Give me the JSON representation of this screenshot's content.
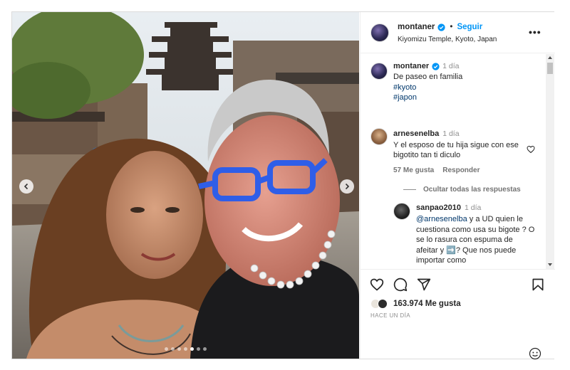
{
  "post": {
    "username": "montaner",
    "follow_label": "Seguir",
    "separator": "•",
    "location": "Kiyomizu Temple, Kyoto, Japan",
    "more_label": "•••",
    "media_dots_total": 7,
    "media_dots_active": 4
  },
  "caption": {
    "username": "montaner",
    "time": "1 día",
    "text": "De paseo en familia",
    "hashtags": [
      "#kyoto",
      "#japon"
    ]
  },
  "comments": [
    {
      "username": "arnesenelba",
      "time": "1 día",
      "text": "Y el esposo de tu hija sigue con ese bigotito tan ti diculo",
      "likes": "57 Me gusta",
      "reply_label": "Responder",
      "hide_replies_label": "Ocultar todas las respuestas"
    }
  ],
  "replies": [
    {
      "username": "sanpao2010",
      "time": "1 día",
      "mention": "@arnesenelba",
      "text": " y a UD quien le cuestiona como usa su bigote ? O se lo rasura con espuma de afeitar y ➡️? Que nos puede importar como"
    }
  ],
  "footer": {
    "likes": "163.974 Me gusta",
    "when": "HACE UN DÍA"
  },
  "colors": {
    "accent": "#0095f6",
    "verified": "#0095f6",
    "hashtag": "#00376b",
    "muted": "#8e8e8e",
    "glasses": "#2f5ee8"
  },
  "icons": [
    "verified-badge-icon",
    "heart-icon",
    "comment-icon",
    "share-icon",
    "bookmark-icon",
    "emoji-icon",
    "chevron-left-icon",
    "chevron-right-icon"
  ]
}
